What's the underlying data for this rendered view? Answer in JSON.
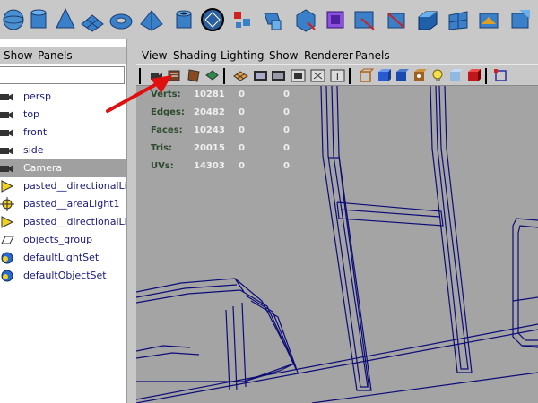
{
  "shelf": {
    "icons": [
      "sphere-icon",
      "cylinder-icon",
      "cone-icon",
      "plane-icon",
      "torus-icon",
      "pyramid-icon",
      "pipe-icon",
      "separator",
      "sphere-poly-icon",
      "combine-icon",
      "separate-icon",
      "extract-icon",
      "smooth-icon",
      "bevel-icon",
      "split-icon",
      "extrude-icon",
      "bridge-icon",
      "append-icon"
    ]
  },
  "outliner": {
    "menu": {
      "show": "Show",
      "panels": "Panels"
    },
    "items": [
      {
        "label": "persp",
        "icon": "camera-icon",
        "selected": false
      },
      {
        "label": "top",
        "icon": "camera-icon",
        "selected": false
      },
      {
        "label": "front",
        "icon": "camera-icon",
        "selected": false
      },
      {
        "label": "side",
        "icon": "camera-icon",
        "selected": false
      },
      {
        "label": "Camera",
        "icon": "camera-icon",
        "selected": true
      },
      {
        "label": "pasted__directionalLigh",
        "icon": "directional-light-icon",
        "selected": false
      },
      {
        "label": "pasted__areaLight1",
        "icon": "area-light-icon",
        "selected": false
      },
      {
        "label": "pasted__directionalLigh",
        "icon": "directional-light-icon",
        "selected": false
      },
      {
        "label": "objects_group",
        "icon": "group-icon",
        "selected": false
      },
      {
        "label": "defaultLightSet",
        "icon": "set-icon",
        "selected": false
      },
      {
        "label": "defaultObjectSet",
        "icon": "set-icon",
        "selected": false
      }
    ]
  },
  "panel": {
    "menu": {
      "view": "View",
      "shading": "Shading",
      "lighting": "Lighting",
      "show": "Show",
      "renderer": "Renderer",
      "panels": "Panels"
    }
  },
  "hud": [
    {
      "label": "Verts:",
      "v1": "10281",
      "v2": "0",
      "v3": "0"
    },
    {
      "label": "Edges:",
      "v1": "20482",
      "v2": "0",
      "v3": "0"
    },
    {
      "label": "Faces:",
      "v1": "10243",
      "v2": "0",
      "v3": "0"
    },
    {
      "label": "Tris:",
      "v1": "20015",
      "v2": "0",
      "v3": "0"
    },
    {
      "label": "UVs:",
      "v1": "14303",
      "v2": "0",
      "v3": "0"
    }
  ],
  "colors": {
    "viewport_bg": "#a4a4a4",
    "wireframe": "#0c0c78",
    "annotation_arrow": "#e01010",
    "selection": "#a0a0a0"
  }
}
